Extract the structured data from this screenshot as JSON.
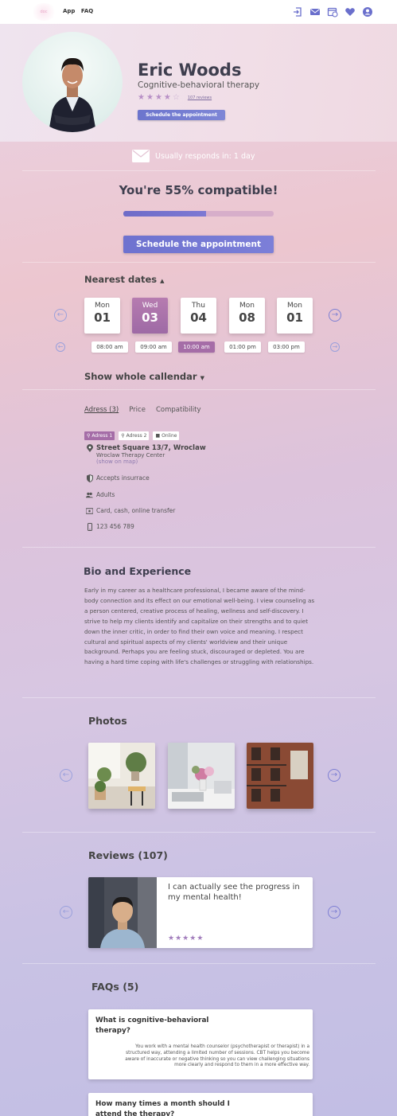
{
  "topbar": {
    "logo_text": "doc",
    "nav": [
      "App",
      "FAQ"
    ],
    "icons": [
      "login-icon",
      "mail-icon",
      "calendar-icon",
      "heart-icon",
      "user-icon"
    ]
  },
  "profile": {
    "name": "Eric Woods",
    "specialty": "Cognitive-behavioral therapy",
    "rating_filled": 4,
    "rating_max": 5,
    "reviews_link": "107 reviews",
    "schedule_small": "Schedule the appointment"
  },
  "response": {
    "text": "Usually responds in: 1 day"
  },
  "compat": {
    "text": "You're 55% compatible!",
    "percent": 55
  },
  "schedule_btn": "Schedule the appointment",
  "nearest": {
    "title": "Nearest dates",
    "dates": [
      {
        "dow": "Mon",
        "day": "01"
      },
      {
        "dow": "Wed",
        "day": "03"
      },
      {
        "dow": "Thu",
        "day": "04"
      },
      {
        "dow": "Mon",
        "day": "08"
      },
      {
        "dow": "Mon",
        "day": "01"
      }
    ],
    "selected_date": 1,
    "times": [
      "08:00 am",
      "09:00 am",
      "10:00 am",
      "01:00 pm",
      "03:00 pm"
    ],
    "selected_time": 2,
    "show_calendar": "Show whole callendar"
  },
  "info_tabs": [
    "Adress (3)",
    "Price",
    "Compatibility"
  ],
  "address_chips": [
    "Adress 1",
    "Adress 2",
    "Online"
  ],
  "address": {
    "street": "Street Square 13/7, Wroclaw",
    "center": "Wroclaw Therapy Center",
    "map_link": "(show on map)"
  },
  "details": {
    "insurance": "Accepts insurrace",
    "audience": "Adults",
    "payment": "Card, cash, online transfer",
    "phone": "123 456 789"
  },
  "bio": {
    "title": "Bio and Experience",
    "text": "Early in my career as a healthcare professional, I became aware of the mind-body connection and its effect on our emotional well-being. I view counseling as a person centered, creative process of healing, wellness and self-discovery. I strive to help my clients identify and capitalize on their strengths and to quiet down the inner critic, in order to find their own voice and meaning. I respect cultural and spiritual aspects of my clients' worldview and their unique background. Perhaps you are feeling stuck, discouraged or depleted. You are having a hard time coping with life's challenges or struggling with relationships."
  },
  "photos": {
    "title": "Photos",
    "items": [
      "plants-chair-photo",
      "desk-flowers-photo",
      "brick-building-photo"
    ]
  },
  "reviews": {
    "title": "Reviews (107)",
    "quote": "I can actually see the progress in my mental health!",
    "stars": 5
  },
  "faqs": {
    "title": "FAQs (5)",
    "items": [
      {
        "q": "What is cognitive-behavioral therapy?",
        "a": "You work with a mental health counselor (psychotherapist or therapist) in a structured way, attending a limited number of sessions. CBT helps you become aware of inaccurate or negative thinking so you can view challenging situations more clearly and respond to them in a more effective way."
      },
      {
        "q": "How many times a month should I attend the therapy?",
        "a": ""
      }
    ]
  },
  "colors": {
    "accent": "#7d7fd3",
    "selected": "#a56da7",
    "star": "#b78fc6"
  }
}
